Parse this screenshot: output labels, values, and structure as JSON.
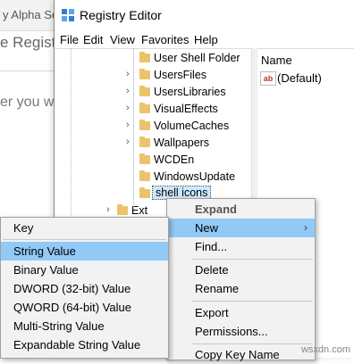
{
  "background": {
    "tab_text": "y Alpha Ser",
    "heading": "e Registry",
    "body_text": "er you wa"
  },
  "window": {
    "title": "Registry Editor",
    "menu": [
      "File",
      "Edit",
      "View",
      "Favorites",
      "Help"
    ]
  },
  "tree": {
    "items": [
      {
        "label": "User Shell Folder",
        "expander": false
      },
      {
        "label": "UsersFiles",
        "expander": true
      },
      {
        "label": "UsersLibraries",
        "expander": true
      },
      {
        "label": "VisualEffects",
        "expander": true
      },
      {
        "label": "VolumeCaches",
        "expander": true
      },
      {
        "label": "Wallpapers",
        "expander": true
      },
      {
        "label": "WCDEn",
        "expander": false
      },
      {
        "label": "WindowsUpdate",
        "expander": false
      },
      {
        "label": "shell icons",
        "expander": false,
        "selected": true
      },
      {
        "label": "Ext",
        "expander": true
      }
    ]
  },
  "right_pane": {
    "column_name": "Name",
    "value_icon": "ab-string-icon",
    "value_name": "(Default)"
  },
  "context_menu": {
    "items": [
      {
        "label": "Expand",
        "style": "bold"
      },
      {
        "label": "New",
        "highlighted": true,
        "submenu": true
      },
      {
        "label": "Find..."
      },
      {
        "label": "Delete"
      },
      {
        "label": "Rename"
      },
      {
        "label": "Export"
      },
      {
        "label": "Permissions..."
      },
      {
        "label": "Copy Key Name"
      }
    ]
  },
  "submenu": {
    "items": [
      {
        "label": "Key"
      },
      {
        "label": "String Value",
        "highlighted": true
      },
      {
        "label": "Binary Value"
      },
      {
        "label": "DWORD (32-bit) Value"
      },
      {
        "label": "QWORD (64-bit) Value"
      },
      {
        "label": "Multi-String Value"
      },
      {
        "label": "Expandable String Value"
      }
    ]
  },
  "watermark": "wsxdn.com",
  "colors": {
    "highlight": "#91c9f7",
    "selection": "#cce8ff",
    "folder": "#e9c46a",
    "menu_bg": "#f2f2f2"
  }
}
